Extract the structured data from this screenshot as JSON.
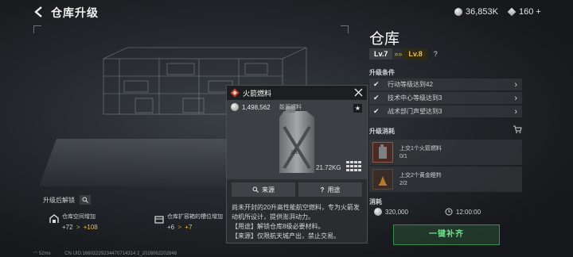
{
  "header": {
    "title": "仓库升级",
    "currency_silver": "36,853K",
    "currency_premium": "160",
    "premium_add": "+"
  },
  "panel": {
    "title": "仓库",
    "level_current": "Lv.7",
    "level_next": "Lv.8",
    "help": "?",
    "conditions_label": "升级条件",
    "conditions": [
      {
        "text": "行动等级达到42"
      },
      {
        "text": "技术中心等级达到3"
      },
      {
        "text": "战术部门声望达到3"
      }
    ],
    "cost_label": "升级消耗",
    "costs": [
      {
        "name": "上交1个火箭燃料",
        "count": "0/1"
      },
      {
        "name": "上交2个黄金瞪羚",
        "count": "2/2"
      }
    ],
    "consume_label": "消耗",
    "consume_money": "320,000",
    "consume_time": "12:00:00",
    "upgrade_button": "一键补齐"
  },
  "left": {
    "unlock_label": "升级后解锁",
    "bonus1": {
      "label": "仓库空间增加",
      "old": "+72",
      "arrow": ">",
      "new": "+108"
    },
    "bonus2": {
      "label": "仓库扩容箱的槽位增加",
      "old": "+6",
      "arrow": ">",
      "new": "+7"
    },
    "ping": "52ms",
    "uid": "CN UID:16602229234470714314 2_2026062202848"
  },
  "popup": {
    "title": "火箭燃料",
    "price": "1,498,562",
    "category": "能源燃料",
    "weight": "21.72KG",
    "source_button": "来源",
    "use_button": "用途",
    "desc": [
      "尚未开封的20升高性能航空燃料，专为火箭发动机所设计，提供澎湃动力。",
      "【用途】解锁仓库8级必要材料。",
      "【来源】仅限航天城产出，禁止交易。"
    ]
  },
  "colors": {
    "accent_gold": "#e6c04a",
    "accent_green": "#6ee08a",
    "popup_red": "#c0392b"
  }
}
